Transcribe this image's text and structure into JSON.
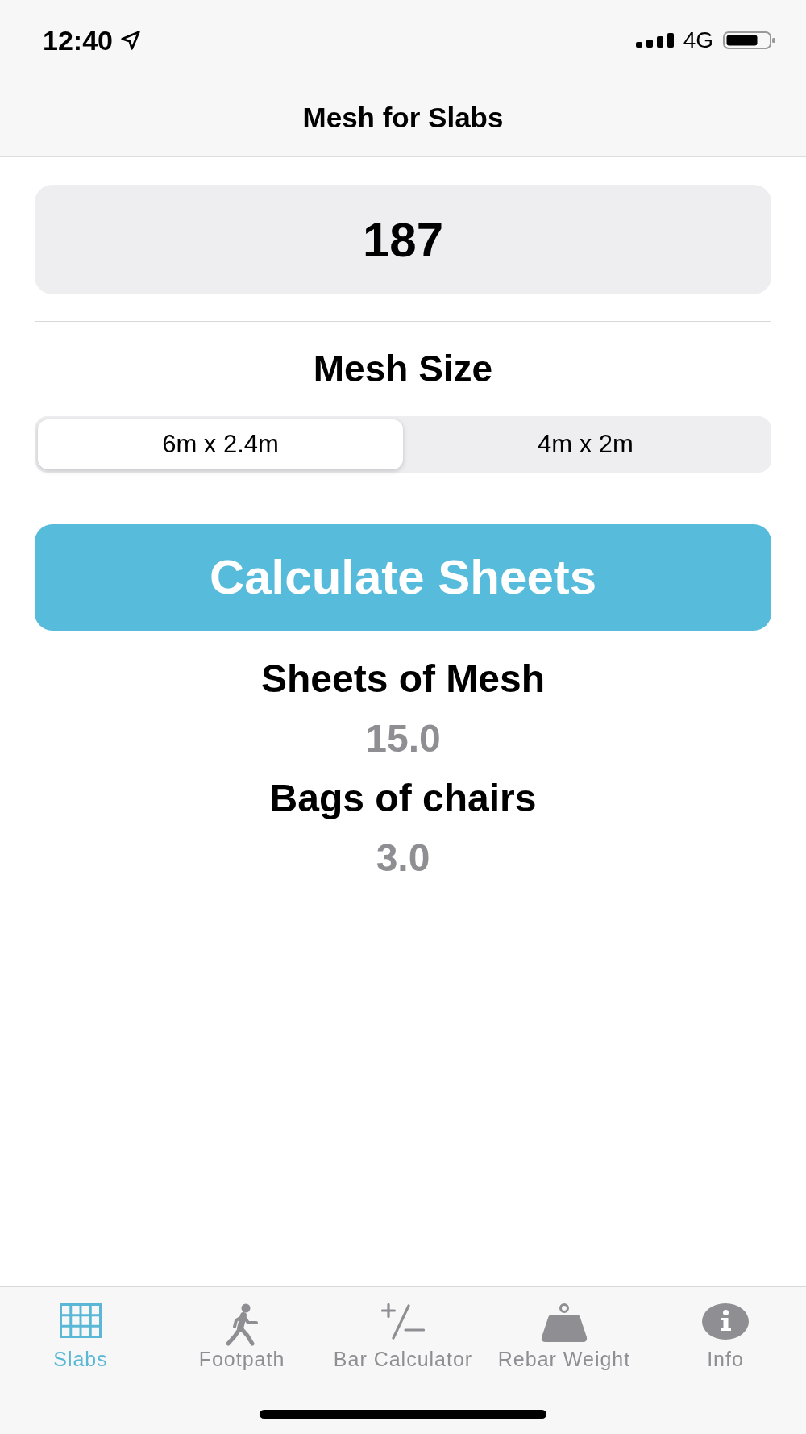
{
  "status_bar": {
    "time": "12:40",
    "network": "4G"
  },
  "nav_bar": {
    "title": "Mesh for Slabs"
  },
  "input_field": {
    "value": "187"
  },
  "mesh_size": {
    "label": "Mesh Size",
    "options": [
      {
        "label": "6m x 2.4m",
        "selected": true
      },
      {
        "label": "4m x 2m",
        "selected": false
      }
    ]
  },
  "calculate_button": {
    "label": "Calculate Sheets"
  },
  "results": [
    {
      "label": "Sheets of Mesh",
      "value": "15.0"
    },
    {
      "label": "Bags of chairs",
      "value": "3.0"
    }
  ],
  "tab_bar": {
    "items": [
      {
        "label": "Slabs",
        "selected": true
      },
      {
        "label": "Footpath",
        "selected": false
      },
      {
        "label": "Bar Calculator",
        "selected": false
      },
      {
        "label": "Rebar Weight",
        "selected": false
      },
      {
        "label": "Info",
        "selected": false
      }
    ]
  }
}
